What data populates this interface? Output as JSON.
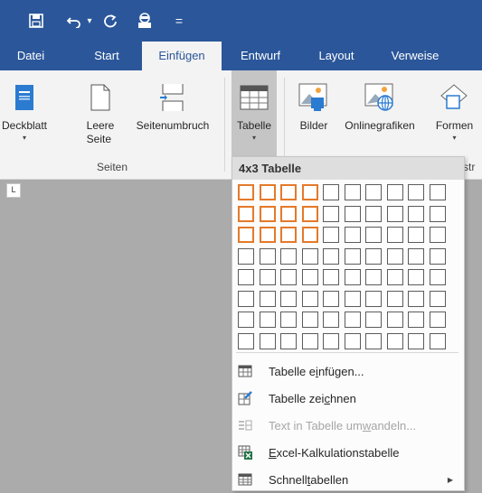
{
  "quick_access": {
    "save_icon": "save-icon",
    "undo_icon": "undo-icon",
    "redo_icon": "redo-icon",
    "touch_icon": "touch-mode-icon",
    "customize": "="
  },
  "tabs": [
    {
      "label": "Datei"
    },
    {
      "label": "Start"
    },
    {
      "label": "Einfügen",
      "active": true
    },
    {
      "label": "Entwurf"
    },
    {
      "label": "Layout"
    },
    {
      "label": "Verweise"
    }
  ],
  "ribbon": {
    "cover_page": {
      "label": "Deckblatt"
    },
    "blank_page": {
      "label": "Leere\nSeite"
    },
    "page_break": {
      "label": "Seitenumbruch"
    },
    "pages_group": "Seiten",
    "table": {
      "label": "Tabelle"
    },
    "pictures": {
      "label": "Bilder"
    },
    "online_pictures": {
      "label": "Onlinegrafiken"
    },
    "shapes": {
      "label": "Formen"
    },
    "illustrations_group_partial": "str"
  },
  "ruler_marker": "L",
  "table_dropdown": {
    "header": "4x3 Tabelle",
    "grid": {
      "columns": 10,
      "rows": 8,
      "selected_columns": 4,
      "selected_rows": 3
    },
    "menu": [
      {
        "pre": "Tabelle e",
        "u": "i",
        "post": "nfügen...",
        "icon": "insert-table-icon",
        "disabled": false
      },
      {
        "pre": "Tabelle zei",
        "u": "c",
        "post": "hnen",
        "icon": "draw-table-icon",
        "disabled": false
      },
      {
        "pre": "Text in Tabelle um",
        "u": "w",
        "post": "andeln...",
        "icon": "convert-text-icon",
        "disabled": true
      },
      {
        "pre": "",
        "u": "E",
        "post": "xcel-Kalkulationstabelle",
        "icon": "excel-table-icon",
        "disabled": false
      },
      {
        "pre": "Schnell",
        "u": "t",
        "post": "abellen",
        "icon": "quick-tables-icon",
        "disabled": false,
        "submenu": true
      }
    ]
  },
  "colors": {
    "accent": "#2b579a",
    "highlight": "#e5792a"
  }
}
